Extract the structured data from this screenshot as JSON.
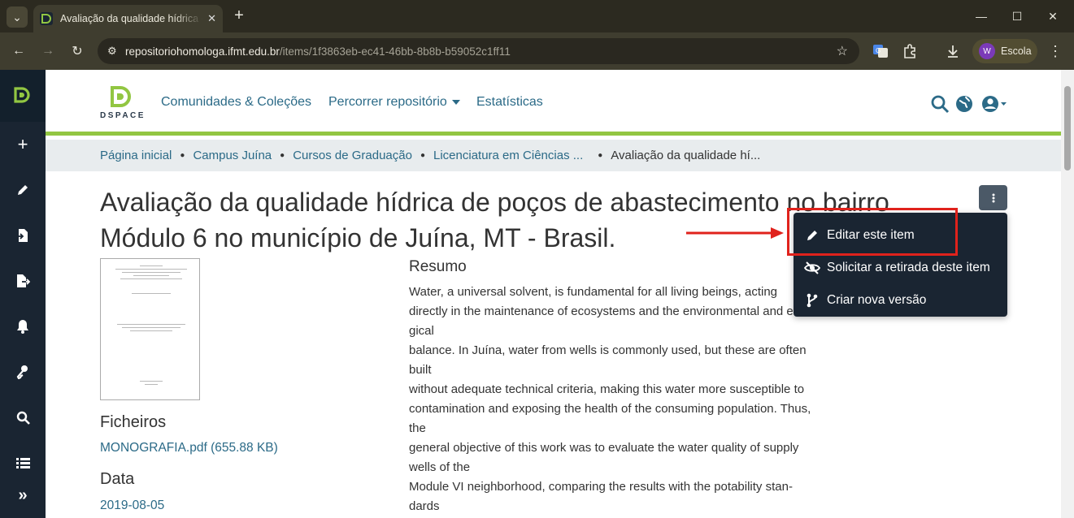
{
  "browser": {
    "tab_title": "Avaliação da qualidade hídrica de poços",
    "url_host": "repositoriohomologa.ifmt.edu.br",
    "url_path": "/items/1f3863eb-ec41-46bb-8b8b-b59052c1ff11",
    "profile_initial": "W",
    "profile_name": "Escola"
  },
  "header": {
    "logo_text": "DSPACE",
    "nav": [
      "Comunidades & Coleções",
      "Percorrer repositório",
      "Estatísticas"
    ]
  },
  "breadcrumb": [
    "Página inicial",
    "Campus Juína",
    "Cursos de Graduação",
    "Licenciatura em Ciências ...",
    "Avaliação da qualidade hí..."
  ],
  "item": {
    "title_line1": "Avaliação da qualidade hídrica de poços de abastecimento no bairro",
    "title_line2": "Módulo 6 no município de Juína, MT - Brasil.",
    "files_heading": "Ficheiros",
    "file_link": "MONOGRAFIA.pdf (655.88 KB)",
    "date_heading": "Data",
    "date_value": "2019-08-05",
    "abstract_heading": "Resumo",
    "abstract_lines": [
      "Water, a universal solvent, is fundamental for all living beings, acting",
      "directly in the maintenance of ecosystems and the environmental and ecolo-",
      "gical",
      "balance. In Juína, water from wells is commonly used, but these are often",
      "built",
      "without adequate technical criteria, making this water more susceptible to",
      "contamination and exposing the health of the consuming population. Thus,",
      "the",
      "general objective of this work was to evaluate the water quality of supply",
      "wells of the",
      "Module VI neighborhood, comparing the results with the potability stan-",
      "dards"
    ]
  },
  "context_menu": {
    "items": [
      "Editar este item",
      "Solicitar a retirada deste item",
      "Criar nova versão"
    ]
  },
  "colors": {
    "accent_green": "#92c642",
    "link": "#2b6a87",
    "sidebar": "#1a2532",
    "highlight": "#e0221c"
  }
}
